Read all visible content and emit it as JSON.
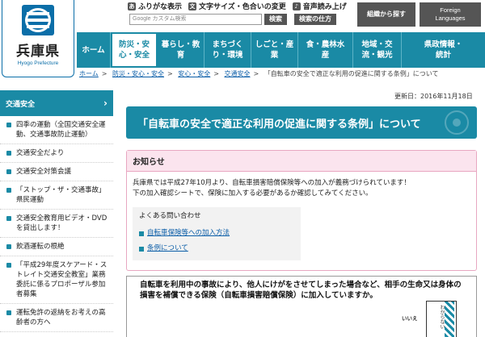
{
  "logo": {
    "name": "兵庫県",
    "sub": "Hyogo Prefecture"
  },
  "util": [
    {
      "icon": "あ",
      "label": "ふりがな表示"
    },
    {
      "icon": "文",
      "label": "文字サイズ・色合いの変更"
    },
    {
      "icon": "♪",
      "label": "音声読み上げ"
    }
  ],
  "search": {
    "placeholder": "Google カスタム検索",
    "button": "検索",
    "help": "検索の仕方"
  },
  "header_buttons": {
    "org": "組織から探す",
    "lang_line1": "Foreign",
    "lang_line2": "Languages"
  },
  "nav": [
    {
      "label": "ホーム"
    },
    {
      "label": "防災・安\n心・安全"
    },
    {
      "label": "暮らし・教\n育"
    },
    {
      "label": "まちづく\nり・環境"
    },
    {
      "label": "しごと・産\n業"
    },
    {
      "label": "食・農林水\n産"
    },
    {
      "label": "地域・交\n流・観光"
    },
    {
      "label": "県政情報・\n統計"
    }
  ],
  "breadcrumb": {
    "links": [
      "ホーム",
      "防災・安心・安全",
      "安心・安全",
      "交通安全"
    ],
    "current": "「自転車の安全で適正な利用の促進に関する条例」について"
  },
  "sidebar": {
    "head": "交通安全",
    "items": [
      "四季の運動（全国交通安全運動、交通事故防止運動）",
      "交通安全だより",
      "交通安全対策会議",
      "「ストップ・ザ・交通事故」県民運動",
      "交通安全教育用ビデオ・DVDを貸出します！",
      "飲酒運転の根絶",
      "「平成29年度スケアード・ストレイト交通安全教室」業務委託に係るプロポーザル参加者募集",
      "運転免許の返納をお考えの高齢者の方へ"
    ]
  },
  "main": {
    "updated": "更新日：2016年11月18日",
    "title": "「自転車の安全で適正な利用の促進に関する条例」について",
    "notice_head": "お知らせ",
    "notice_line1": "兵庫県では平成27年10月より、自転車損害賠償保険等への加入が義務づけられています！",
    "notice_line2": "下の加入確認シートで、保険に加入する必要があるか確認してみてください。",
    "faq_title": "よくある問い合わせ",
    "faq_links": [
      "自転車保険等への加入方法",
      "条例について"
    ],
    "illus_text": "自転車を利用中の事故により、他人にけがをさせてしまった場合など、相手の生命又は身体の損害を補償できる保険（自転車損害賠償保険）に加入していますか。",
    "sign_text": "わからない",
    "pole_text": "いいえ"
  }
}
